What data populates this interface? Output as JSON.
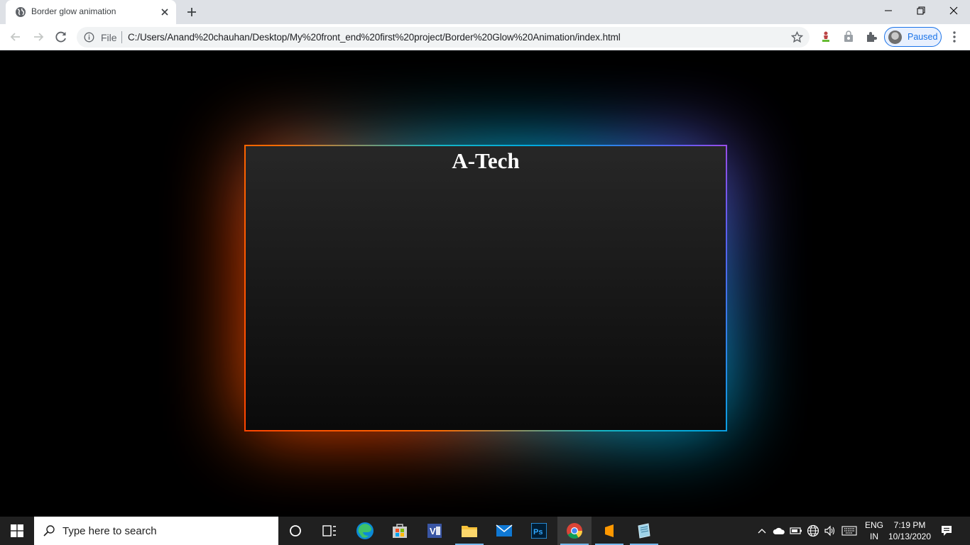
{
  "browser": {
    "tab": {
      "title": "Border glow animation",
      "favicon": "globe-icon"
    },
    "toolbar": {
      "origin_label": "File",
      "url": "C:/Users/Anand%20chauhan/Desktop/My%20front_end%20first%20project/Border%20Glow%20Animation/index.html",
      "profile_status": "Paused"
    }
  },
  "page": {
    "heading": "A-Tech",
    "border_gradient_colors": [
      "#ff4500",
      "#16b6c4",
      "#00a7e0",
      "#9a4de8"
    ]
  },
  "taskbar": {
    "search_placeholder": "Type here to search",
    "language_top": "ENG",
    "language_bottom": "IN",
    "time": "7:19 PM",
    "date": "10/13/2020",
    "pinned": [
      "cortana-icon",
      "task-view-icon",
      "edge-icon",
      "store-icon",
      "visio-icon",
      "file-explorer-icon",
      "mail-icon",
      "photoshop-icon",
      "chrome-icon",
      "sublime-text-icon",
      "notepad-icon"
    ]
  }
}
